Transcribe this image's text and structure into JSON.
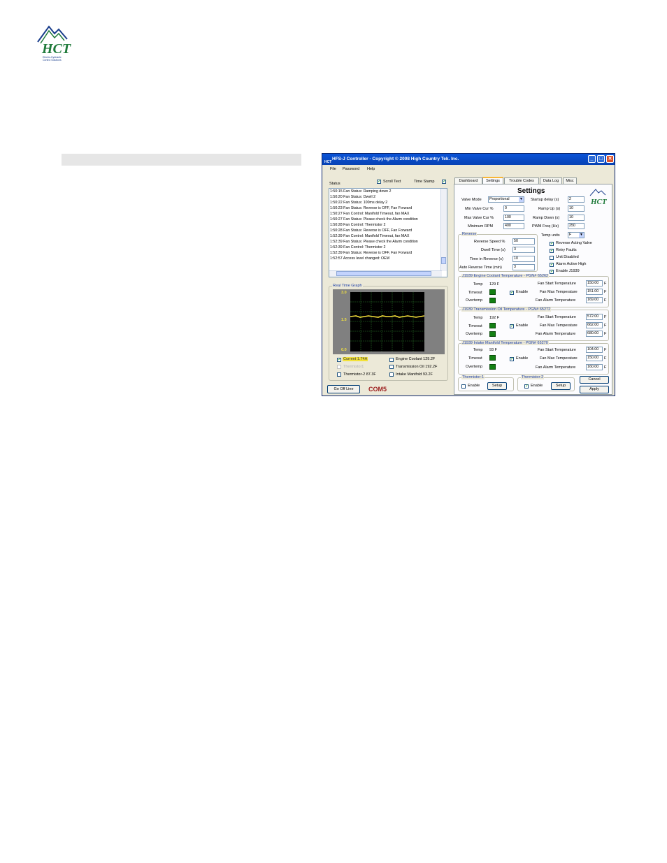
{
  "brand": {
    "logo_text": "HCT",
    "tagline_line1": "Electro-Hydraulic",
    "tagline_line2": "Control Solutions",
    "green": "#1f7a3a",
    "blue": "#1a3e8c"
  },
  "window": {
    "title": "HFS-J Controller - Copyright © 2008 High Country Tek. Inc.",
    "title_icon": "HCT",
    "buttons": {
      "minimize": "_",
      "maximize": "□",
      "close": "✕"
    },
    "menu": [
      "File",
      "Password",
      "Help"
    ]
  },
  "status": {
    "label": "Status",
    "scroll_text_label": "Scroll Text",
    "scroll_text_checked": true,
    "time_stamp_label": "Time Stamp",
    "time_stamp_checked": true,
    "lines": [
      "1:50:15  Fan Status: Ramping down 2",
      "1:50:20  Fan Status: Dwell 2",
      "1:50:22  Fan Status: 100ms delay 2",
      "1:50:23  Fan Status: Reverse is OFF, Fan Forward",
      "1:50:27  Fan Control: Manifold Timeout, fan MAX",
      "1:50:27  Fan Status: Please check the Alarm condition",
      "1:50:28  Fan Control: Thermistor 2",
      "1:50:28  Fan Status: Reverse is OFF, Fan Forward",
      "1:52:39  Fan Control: Manifold Timeout, fan MAX",
      "1:52:39  Fan Status: Please check the Alarm condition",
      "1:52:39  Fan Control: Thermistor 2",
      "1:52:39  Fan Status: Reverse is OFF, Fan Forward",
      "1:52:57  Access level changed: OEM"
    ]
  },
  "graph": {
    "label": "Real Time Graph",
    "y_ticks": [
      "3.0",
      "1.5",
      "0.0"
    ],
    "legend": [
      {
        "label": "Current 1.74A",
        "checked": true,
        "highlight": true,
        "disabled": false
      },
      {
        "label": "Engine Coolant 129.2F",
        "checked": false,
        "highlight": false,
        "disabled": false
      },
      {
        "label": "Thermistor1",
        "checked": false,
        "highlight": false,
        "disabled": true
      },
      {
        "label": "Transmission Oil 192.2F",
        "checked": false,
        "highlight": false,
        "disabled": false
      },
      {
        "label": "Thermistor-2 87.3F",
        "checked": false,
        "highlight": false,
        "disabled": false
      },
      {
        "label": "Intake Manifold 93.2F",
        "checked": false,
        "highlight": false,
        "disabled": false
      }
    ]
  },
  "footer": {
    "go_offline": "Go Off Line",
    "port": "COM5"
  },
  "tabs": [
    "Dashboard",
    "Settings",
    "Trouble Codes",
    "Data Log",
    "Misc"
  ],
  "active_tab": "Settings",
  "settings": {
    "title": "Settings",
    "valve_mode_label": "Valve Mode",
    "valve_mode_value": "Proportional",
    "min_valve_label": "Min Valve Cur %",
    "min_valve_value": "0",
    "max_valve_label": "Max Valve Cur %",
    "max_valve_value": "100",
    "min_rpm_label": "Minimum RPM",
    "min_rpm_value": "400",
    "startup_delay_label": "Startup delay (s)",
    "startup_delay_value": "2",
    "ramp_up_label": "Ramp Up (s)",
    "ramp_up_value": "10",
    "ramp_down_label": "Ramp Down (s)",
    "ramp_down_value": "10",
    "pwm_label": "PWM Freq (Hz)",
    "pwm_value": "250",
    "temp_units_label": "Temp units",
    "temp_units_value": "F"
  },
  "reverse": {
    "label": "Reverse",
    "speed_label": "Reverse Speed %",
    "speed_value": "50",
    "dwell_label": "Dwell Time (s)",
    "dwell_value": "3",
    "time_label": "Time in Reverse (s)",
    "time_value": "10",
    "auto_label": "Auto Reverse Time (min)",
    "auto_value": "3"
  },
  "options": [
    {
      "label": "Reverse Acting Valve",
      "checked": true
    },
    {
      "label": "Retry Faults",
      "checked": true
    },
    {
      "label": "Unit Disabled",
      "checked": false
    },
    {
      "label": "Alarm Active High",
      "checked": true
    },
    {
      "label": "Enable J1939",
      "checked": true
    }
  ],
  "j1939": [
    {
      "title": "J1939 Engine Coolant Temperature - PGN# 65262",
      "temp": "129 F",
      "start": "150.00",
      "max": "151.00",
      "alarm": "169.00"
    },
    {
      "title": "J1939 Transmission Oil Temperature - PGN# 65272",
      "temp": "192 F",
      "start": "572.00",
      "max": "662.00",
      "alarm": "680.00"
    },
    {
      "title": "J1939 Intake Manifold Temperature - PGN# 65270",
      "temp": "93 F",
      "start": "104.00",
      "max": "150.00",
      "alarm": "160.00"
    }
  ],
  "j1939_labels": {
    "temp": "Temp",
    "timeout": "Timeout",
    "overtemp": "Overtemp",
    "enable": "Enable",
    "fan_start": "Fan Start Temperature",
    "fan_max": "Fan Max Temperature",
    "fan_alarm": "Fan Alarm Temperature",
    "unit": "F"
  },
  "thermistors": [
    {
      "title": "Thermistor-1",
      "enable_label": "Enable",
      "checked": false,
      "setup": "Setup"
    },
    {
      "title": "Thermistor-2",
      "enable_label": "Enable",
      "checked": true,
      "setup": "Setup"
    }
  ],
  "actions": {
    "cancel": "Cancel",
    "apply": "Apply"
  }
}
